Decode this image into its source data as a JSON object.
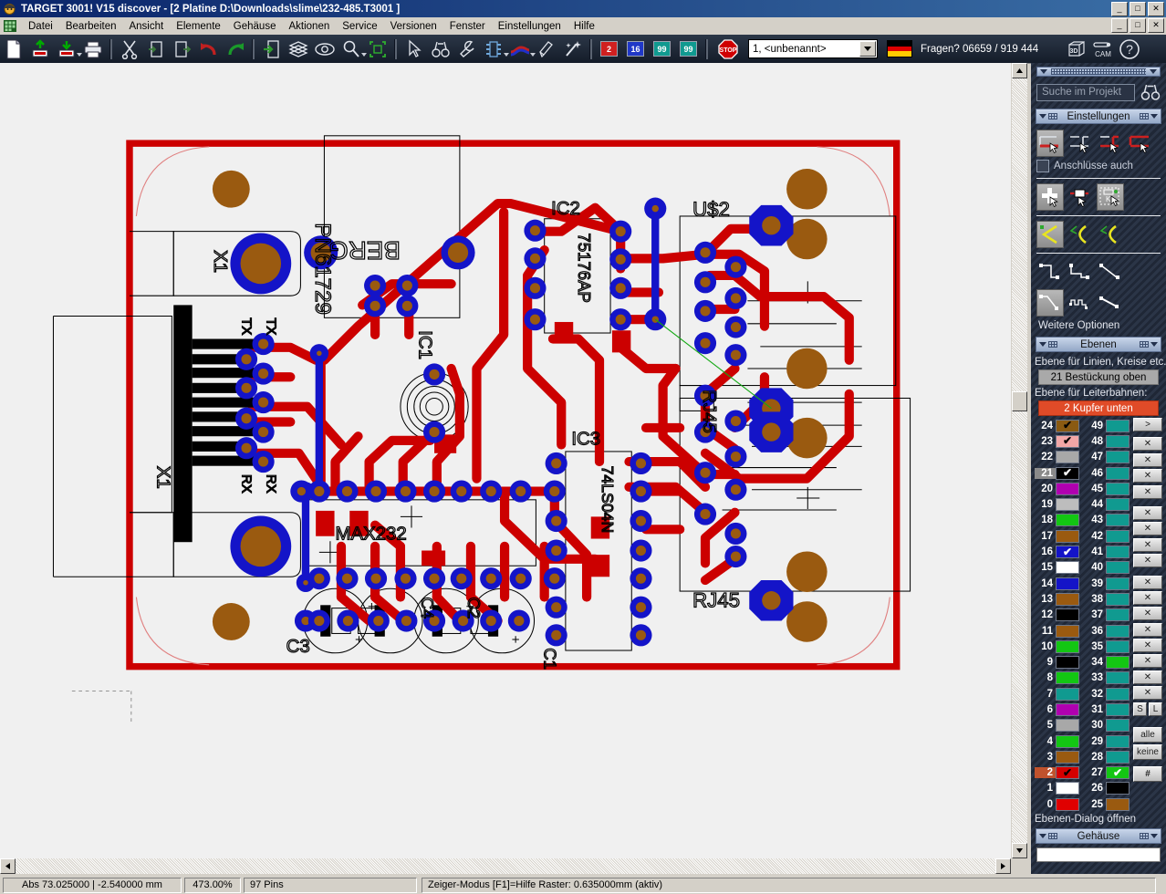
{
  "window": {
    "title": "TARGET 3001! V15 discover - [2 Platine D:\\Downloads\\slime\\232-485.T3001 ]",
    "minimize": "_",
    "maximize": "□",
    "close": "✕"
  },
  "menu": {
    "items": [
      {
        "label": "Datei"
      },
      {
        "label": "Bearbeiten"
      },
      {
        "label": "Ansicht"
      },
      {
        "label": "Elemente"
      },
      {
        "label": "Gehäuse"
      },
      {
        "label": "Aktionen"
      },
      {
        "label": "Service"
      },
      {
        "label": "Versionen"
      },
      {
        "label": "Fenster"
      },
      {
        "label": "Einstellungen"
      },
      {
        "label": "Hilfe"
      }
    ]
  },
  "toolbar": {
    "counters": [
      {
        "value": "2",
        "color": "#d02020",
        "name": "counter-red"
      },
      {
        "value": "16",
        "color": "#2038c8",
        "name": "counter-blue"
      },
      {
        "value": "99",
        "color": "#109a90",
        "name": "counter-teal-1"
      },
      {
        "value": "99",
        "color": "#109a90",
        "name": "counter-teal-2"
      }
    ],
    "project_combo_value": "1, <unbenannt>",
    "support_text": "Fragen? 06659 / 919 444",
    "btn_3d": "3D",
    "btn_cam": "CAM",
    "btn_help": "?"
  },
  "panel": {
    "search_placeholder": "Suche im Projekt",
    "sections": {
      "settings_title": "Einstellungen",
      "layers_title": "Ebenen",
      "housing_title": "Gehäuse"
    },
    "checkbox_label": "Anschlüsse auch",
    "more_options_label": "Weitere Optionen",
    "layer_lines_label": "Ebene für Linien, Kreise etc.:",
    "layer_lines_value": "21 Bestückung oben",
    "layer_tracks_label": "Ebene für Leiterbahnen:",
    "layer_tracks_value": "2 Kupfer unten",
    "open_dialog_label": "Ebenen-Dialog öffnen",
    "buttons": {
      "all": "alle",
      "none": "keine",
      "hash": "#",
      "s": "S",
      "l": "L",
      "arrow": ">"
    },
    "layers_left": [
      {
        "num": "24",
        "color": "#8a5a12",
        "checked": true,
        "check_color": "#000000"
      },
      {
        "num": "23",
        "color": "#f2a7a7",
        "checked": true,
        "check_color": "#000000"
      },
      {
        "num": "22",
        "color": "#a8a8a8",
        "checked": false,
        "check_color": "#000000"
      },
      {
        "num": "21",
        "color": "#000000",
        "checked": true,
        "check_color": "#ffffff",
        "selected": true
      },
      {
        "num": "20",
        "color": "#b000b0",
        "checked": false,
        "check_color": "#000000"
      },
      {
        "num": "19",
        "color": "#bdbdbd",
        "checked": false,
        "check_color": "#000000"
      },
      {
        "num": "18",
        "color": "#13c613",
        "checked": false,
        "check_color": "#000000"
      },
      {
        "num": "17",
        "color": "#9a5a10",
        "checked": false,
        "check_color": "#000000"
      },
      {
        "num": "16",
        "color": "#1414c8",
        "checked": true,
        "check_color": "#ffffff"
      },
      {
        "num": "15",
        "color": "#ffffff",
        "checked": false,
        "check_color": "#000000"
      },
      {
        "num": "14",
        "color": "#1414c8",
        "checked": false,
        "check_color": "#000000"
      },
      {
        "num": "13",
        "color": "#9a5a10",
        "checked": false,
        "check_color": "#000000"
      },
      {
        "num": "12",
        "color": "#000000",
        "checked": false,
        "check_color": "#ffffff"
      },
      {
        "num": "11",
        "color": "#9a5a10",
        "checked": false,
        "check_color": "#000000"
      },
      {
        "num": "10",
        "color": "#13c613",
        "checked": false,
        "check_color": "#000000"
      },
      {
        "num": "9",
        "color": "#000000",
        "checked": false,
        "check_color": "#ffffff"
      },
      {
        "num": "8",
        "color": "#13c613",
        "checked": false,
        "check_color": "#000000"
      },
      {
        "num": "7",
        "color": "#109a90",
        "checked": false,
        "check_color": "#000000"
      },
      {
        "num": "6",
        "color": "#b000b0",
        "checked": false,
        "check_color": "#000000"
      },
      {
        "num": "5",
        "color": "#a8a8a8",
        "checked": false,
        "check_color": "#000000"
      },
      {
        "num": "4",
        "color": "#13c613",
        "checked": false,
        "check_color": "#000000"
      },
      {
        "num": "3",
        "color": "#9a5a10",
        "checked": false,
        "check_color": "#000000"
      },
      {
        "num": "2",
        "color": "#d40000",
        "checked": true,
        "check_color": "#000000",
        "selected2": true
      },
      {
        "num": "1",
        "color": "#ffffff",
        "checked": false,
        "check_color": "#000000"
      },
      {
        "num": "0",
        "color": "#e00000",
        "checked": false,
        "check_color": "#000000"
      }
    ],
    "layers_right": [
      {
        "num": "49",
        "color": "#109a90",
        "checked": false,
        "check_color": "#000000"
      },
      {
        "num": "48",
        "color": "#109a90",
        "checked": false,
        "check_color": "#000000"
      },
      {
        "num": "47",
        "color": "#109a90",
        "checked": false,
        "check_color": "#000000"
      },
      {
        "num": "46",
        "color": "#109a90",
        "checked": false,
        "check_color": "#000000"
      },
      {
        "num": "45",
        "color": "#109a90",
        "checked": false,
        "check_color": "#000000"
      },
      {
        "num": "44",
        "color": "#109a90",
        "checked": false,
        "check_color": "#000000"
      },
      {
        "num": "43",
        "color": "#109a90",
        "checked": false,
        "check_color": "#000000"
      },
      {
        "num": "42",
        "color": "#109a90",
        "checked": false,
        "check_color": "#000000"
      },
      {
        "num": "41",
        "color": "#109a90",
        "checked": false,
        "check_color": "#000000"
      },
      {
        "num": "40",
        "color": "#109a90",
        "checked": false,
        "check_color": "#000000"
      },
      {
        "num": "39",
        "color": "#109a90",
        "checked": false,
        "check_color": "#000000"
      },
      {
        "num": "38",
        "color": "#109a90",
        "checked": false,
        "check_color": "#000000"
      },
      {
        "num": "37",
        "color": "#109a90",
        "checked": false,
        "check_color": "#000000"
      },
      {
        "num": "36",
        "color": "#109a90",
        "checked": false,
        "check_color": "#000000"
      },
      {
        "num": "35",
        "color": "#109a90",
        "checked": false,
        "check_color": "#000000"
      },
      {
        "num": "34",
        "color": "#13c613",
        "checked": false,
        "check_color": "#000000"
      },
      {
        "num": "33",
        "color": "#109a90",
        "checked": false,
        "check_color": "#000000"
      },
      {
        "num": "32",
        "color": "#109a90",
        "checked": false,
        "check_color": "#000000"
      },
      {
        "num": "31",
        "color": "#109a90",
        "checked": false,
        "check_color": "#000000"
      },
      {
        "num": "30",
        "color": "#109a90",
        "checked": false,
        "check_color": "#000000"
      },
      {
        "num": "29",
        "color": "#109a90",
        "checked": false,
        "check_color": "#000000"
      },
      {
        "num": "28",
        "color": "#109a90",
        "checked": false,
        "check_color": "#000000"
      },
      {
        "num": "27",
        "color": "#13c613",
        "checked": true,
        "check_color": "#ffffff"
      },
      {
        "num": "26",
        "color": "#000000",
        "checked": false,
        "check_color": "#ffffff"
      },
      {
        "num": "25",
        "color": "#9a5a10",
        "checked": false,
        "check_color": "#000000"
      }
    ]
  },
  "statusbar": {
    "coords": "Abs 73.025000 | -2.540000 mm",
    "zoom": "473.00%",
    "pins": "97 Pins",
    "mode": "Zeiger-Modus    [F1]=Hilfe    Raster: 0.635000mm (aktiv)"
  },
  "pcb": {
    "labels": {
      "pn61729": "PN61729",
      "berg": "BERG",
      "x1_top": "X1",
      "tx_a": "TX",
      "tx_b": "TX",
      "x1_left": "X1",
      "rx": "RX",
      "ic2": "IC2",
      "ic2_type": "75176AP",
      "ic1": "IC1",
      "u2": "U$2",
      "rj45_a": "RJ45",
      "rj45_b": "RJ45",
      "max232": "MAX232",
      "ic3": "IC3",
      "ic3_type": "74LS04N",
      "c3": "C3",
      "c4": "C4",
      "c2": "C2",
      "c1": "C1"
    },
    "colors": {
      "copper_bottom": "#cc0000",
      "copper_top": "#1414c8",
      "pad": "#9a5a10",
      "silkscreen": "#000000",
      "background": "#f0f0f0",
      "airwire": "#13a813"
    }
  }
}
